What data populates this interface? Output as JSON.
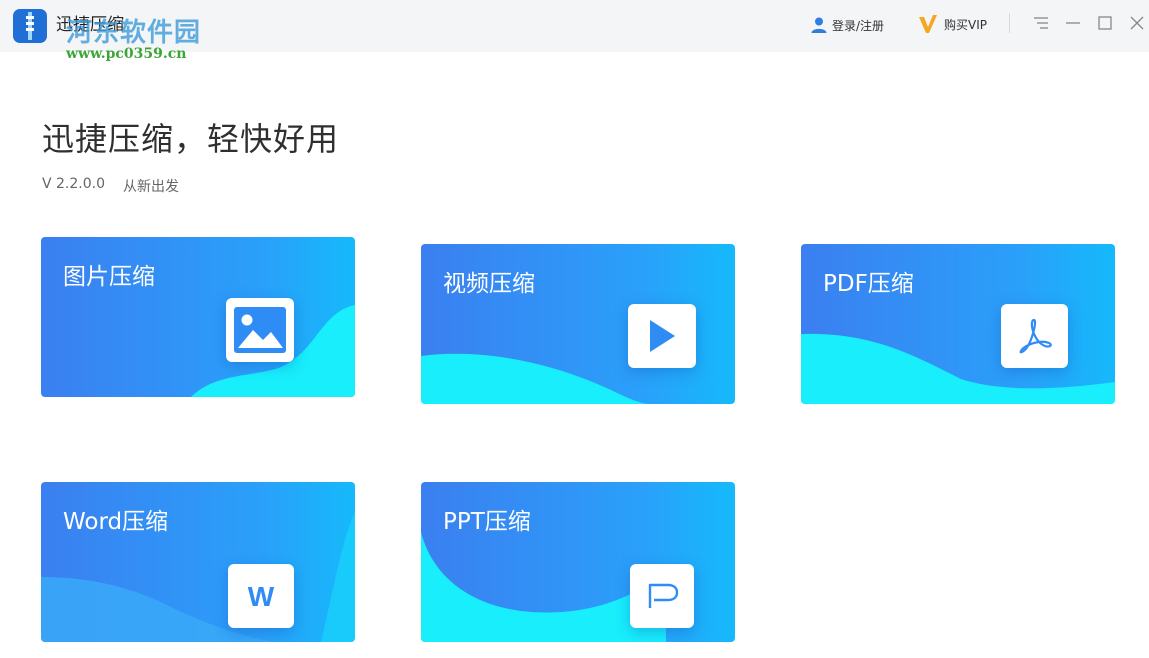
{
  "titlebar": {
    "app_title": "迅捷压缩",
    "login_label": "登录/注册",
    "vip_label": "购买VIP",
    "watermark_text": "河东软件园",
    "watermark_url": "www.pc0359.cn"
  },
  "hero": {
    "title": "迅捷压缩，轻快好用",
    "version": "V 2.2.0.0",
    "tagline": "从新出发"
  },
  "cards": [
    {
      "label": "图片压缩",
      "icon": "image-icon"
    },
    {
      "label": "视频压缩",
      "icon": "play-icon"
    },
    {
      "label": "PDF压缩",
      "icon": "pdf-icon"
    },
    {
      "label": "Word压缩",
      "icon": "word-icon"
    },
    {
      "label": "PPT压缩",
      "icon": "ppt-icon"
    }
  ],
  "colors": {
    "accent": "#2f8cf5",
    "wave": "#18eefc",
    "vip": "#f5a623",
    "login_icon": "#2f7de1"
  }
}
